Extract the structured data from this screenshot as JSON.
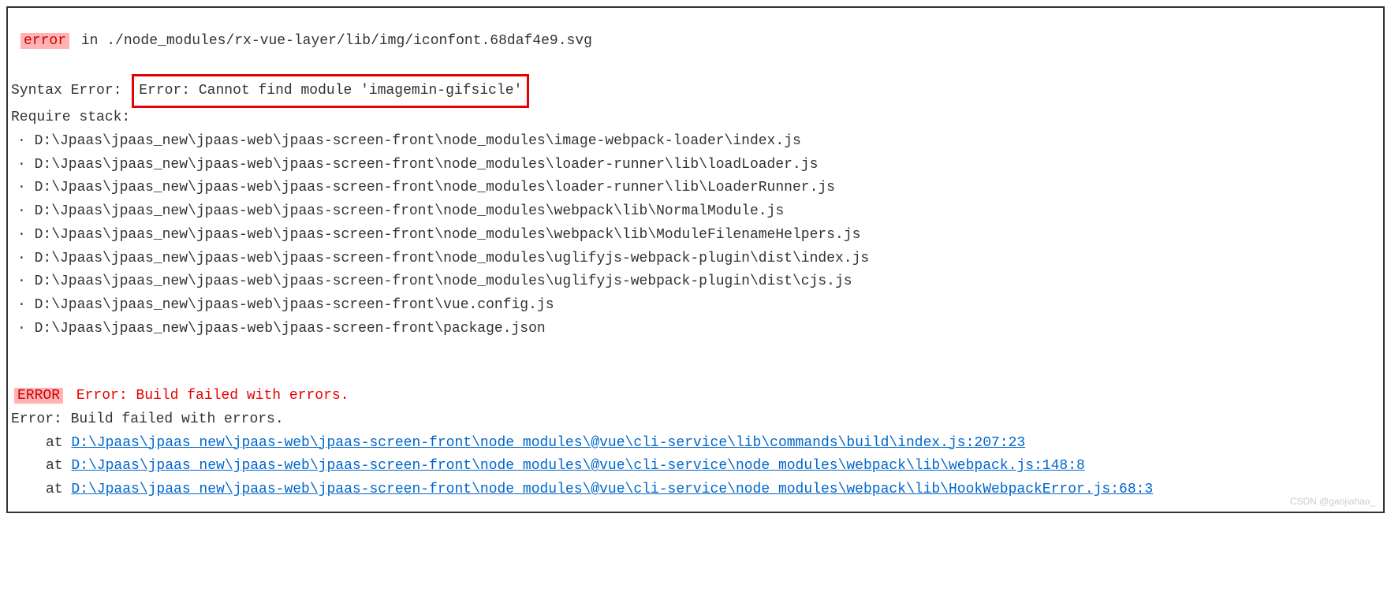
{
  "topError": {
    "label": "error",
    "in": " in ./node_modules/rx-vue-layer/lib/img/iconfont.68daf4e9.svg"
  },
  "syntax": {
    "prefix": "Syntax Error:",
    "highlighted": "Error: Cannot find module 'imagemin-gifsicle'"
  },
  "requireStack": {
    "label": "Require stack:",
    "items": [
      "D:\\Jpaas\\jpaas_new\\jpaas-web\\jpaas-screen-front\\node_modules\\image-webpack-loader\\index.js",
      "D:\\Jpaas\\jpaas_new\\jpaas-web\\jpaas-screen-front\\node_modules\\loader-runner\\lib\\loadLoader.js",
      "D:\\Jpaas\\jpaas_new\\jpaas-web\\jpaas-screen-front\\node_modules\\loader-runner\\lib\\LoaderRunner.js",
      "D:\\Jpaas\\jpaas_new\\jpaas-web\\jpaas-screen-front\\node_modules\\webpack\\lib\\NormalModule.js",
      "D:\\Jpaas\\jpaas_new\\jpaas-web\\jpaas-screen-front\\node_modules\\webpack\\lib\\ModuleFilenameHelpers.js",
      "D:\\Jpaas\\jpaas_new\\jpaas-web\\jpaas-screen-front\\node_modules\\uglifyjs-webpack-plugin\\dist\\index.js",
      "D:\\Jpaas\\jpaas_new\\jpaas-web\\jpaas-screen-front\\node_modules\\uglifyjs-webpack-plugin\\dist\\cjs.js",
      "D:\\Jpaas\\jpaas_new\\jpaas-web\\jpaas-screen-front\\vue.config.js",
      "D:\\Jpaas\\jpaas_new\\jpaas-web\\jpaas-screen-front\\package.json"
    ]
  },
  "buildError": {
    "label": "ERROR",
    "redMsg": " Error: Build failed with errors.",
    "plainMsg": "Error: Build failed with errors.",
    "atLines": [
      {
        "prefix": "at ",
        "link": "D:\\Jpaas\\jpaas_new\\jpaas-web\\jpaas-screen-front\\node_modules\\@vue\\cli-service\\lib\\commands\\build\\index.js:207:23"
      },
      {
        "prefix": "at ",
        "link": "D:\\Jpaas\\jpaas_new\\jpaas-web\\jpaas-screen-front\\node_modules\\@vue\\cli-service\\node_modules\\webpack\\lib\\webpack.js:148:8"
      },
      {
        "prefix": "at ",
        "link": "D:\\Jpaas\\jpaas_new\\jpaas-web\\jpaas-screen-front\\node_modules\\@vue\\cli-service\\node_modules\\webpack\\lib\\HookWebpackError.js:68:3"
      }
    ]
  },
  "watermark": "CSDN @gaojiahao_"
}
